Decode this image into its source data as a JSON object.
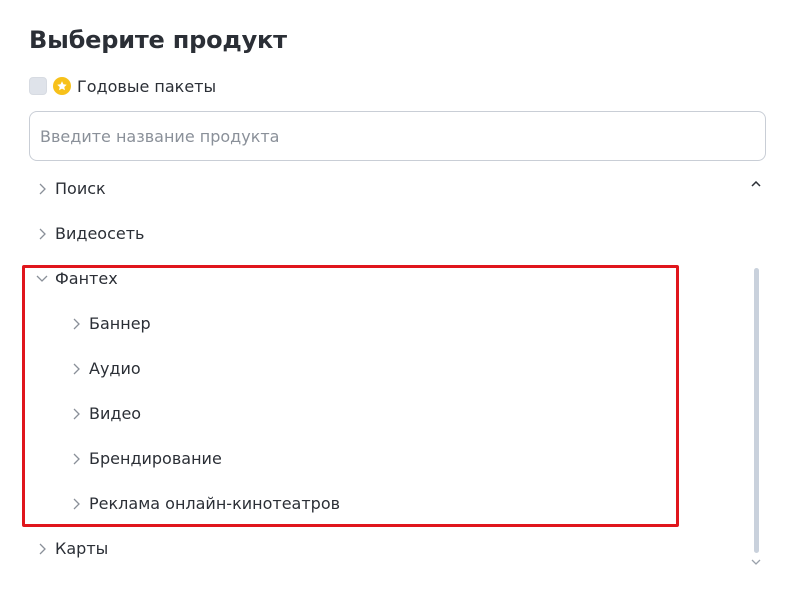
{
  "header": {
    "title": "Выберите продукт"
  },
  "annual_packages": {
    "label": "Годовые пакеты",
    "checked": false,
    "icon": "star-icon"
  },
  "search": {
    "value": "",
    "placeholder": "Введите название продукта"
  },
  "tree": {
    "items": [
      {
        "label": "Поиск",
        "expanded": false,
        "level": 0
      },
      {
        "label": "Видеосеть",
        "expanded": false,
        "level": 0
      },
      {
        "label": "Фантех",
        "expanded": true,
        "level": 0
      },
      {
        "label": "Баннер",
        "expanded": false,
        "level": 1
      },
      {
        "label": "Аудио",
        "expanded": false,
        "level": 1
      },
      {
        "label": "Видео",
        "expanded": false,
        "level": 1
      },
      {
        "label": "Брендирование",
        "expanded": false,
        "level": 1
      },
      {
        "label": "Реклама онлайн-кинотеатров",
        "expanded": false,
        "level": 1
      },
      {
        "label": "Карты",
        "expanded": false,
        "level": 0
      }
    ]
  },
  "colors": {
    "highlight": "#e0161c",
    "star": "#f7c11a",
    "scrollbar": "#c9d1dc"
  }
}
